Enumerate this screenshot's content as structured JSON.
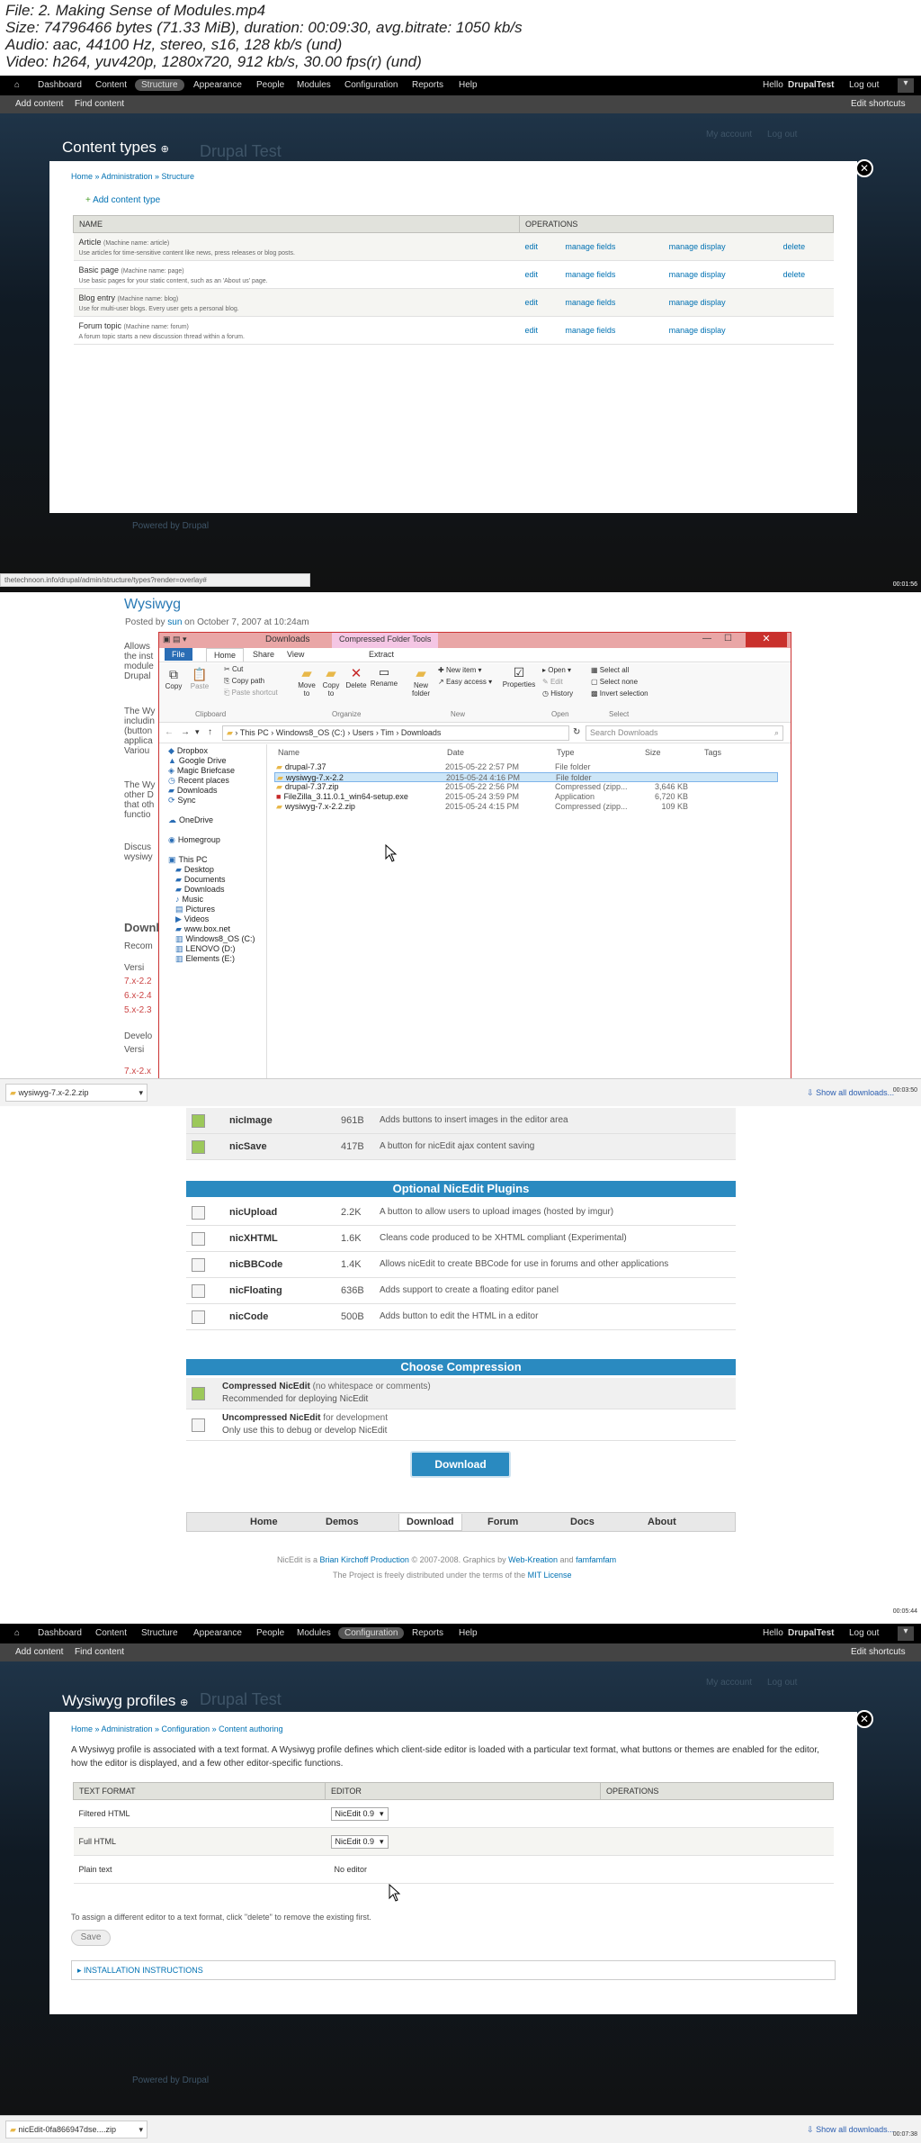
{
  "meta": {
    "file": "File: 2. Making Sense of Modules.mp4",
    "size": "Size: 74796466 bytes (71.33 MiB), duration: 00:09:30, avg.bitrate: 1050 kb/s",
    "audio": "Audio: aac, 44100 Hz, stereo, s16, 128 kb/s (und)",
    "video": "Video: h264, yuv420p, 1280x720, 912 kb/s, 30.00 fps(r) (und)"
  },
  "toolbar": {
    "items": [
      "Dashboard",
      "Content",
      "Structure",
      "Appearance",
      "People",
      "Modules",
      "Configuration",
      "Reports",
      "Help"
    ],
    "hello": "Hello",
    "user": "DrupalTest",
    "logout": "Log out",
    "sub_add": "Add content",
    "sub_find": "Find content",
    "edit_shortcuts": "Edit shortcuts",
    "my_account": "My account",
    "log_out_faint": "Log out",
    "site_name": "Drupal Test",
    "powered": "Powered by Drupal"
  },
  "frame1": {
    "title": "Content types",
    "breadcrumb": "Home » Administration » Structure",
    "add_link": "Add content type",
    "headers": [
      "NAME",
      "OPERATIONS"
    ],
    "rows": [
      {
        "name": "Article",
        "machine": "(Machine name: article)",
        "desc": "Use articles for time-sensitive content like news, press releases or blog posts.",
        "ops": [
          "edit",
          "manage fields",
          "manage display",
          "delete"
        ]
      },
      {
        "name": "Basic page",
        "machine": "(Machine name: page)",
        "desc": "Use basic pages for your static content, such as an 'About us' page.",
        "ops": [
          "edit",
          "manage fields",
          "manage display",
          "delete"
        ]
      },
      {
        "name": "Blog entry",
        "machine": "(Machine name: blog)",
        "desc": "Use for multi-user blogs. Every user gets a personal blog.",
        "ops": [
          "edit",
          "manage fields",
          "manage display",
          ""
        ]
      },
      {
        "name": "Forum topic",
        "machine": "(Machine name: forum)",
        "desc": "A forum topic starts a new discussion thread within a forum.",
        "ops": [
          "edit",
          "manage fields",
          "manage display",
          ""
        ]
      }
    ],
    "status_url": "thetechnoon.info/drupal/admin/structure/types?render=overlay#",
    "timecode": "00:01:56"
  },
  "frame2": {
    "page_title": "Wysiwyg",
    "posted_prefix": "Posted by",
    "posted_user": "sun",
    "posted_rest": "on October 7, 2007 at 10:24am",
    "bg_fragments": [
      "Allows",
      "the inst",
      "module",
      "Drupal",
      "The Wy",
      "includin",
      "(button",
      "applica",
      "Variou",
      "The Wy",
      "other D",
      "that oth",
      "functio",
      "Discus",
      "wysiwy",
      "Downl",
      "Recom",
      "Versi",
      "7.x-2.2",
      "6.x-2.4",
      "5.x-2.3",
      "Develo",
      "Versi",
      "7.x-2.x"
    ],
    "explorer": {
      "title": "Downloads",
      "tools_tab": "Compressed Folder Tools",
      "tabs": [
        "File",
        "Home",
        "Share",
        "View",
        "Extract"
      ],
      "clipboard_btns": [
        "Copy",
        "Paste",
        "Cut",
        "Copy path",
        "Paste shortcut"
      ],
      "groups": [
        "Clipboard",
        "Organize",
        "New",
        "Open",
        "Select"
      ],
      "organize_btns": [
        "Move to",
        "Copy to",
        "Delete",
        "Rename"
      ],
      "new_btns": [
        "New folder",
        "New item",
        "Easy access"
      ],
      "open_btns": [
        "Properties",
        "Open",
        "Edit",
        "History"
      ],
      "select_btns": [
        "Select all",
        "Select none",
        "Invert selection"
      ],
      "path": [
        "This PC",
        "Windows8_OS (C:)",
        "Users",
        "Tim",
        "Downloads"
      ],
      "search_placeholder": "Search Downloads",
      "nav": [
        "Dropbox",
        "Google Drive",
        "Magic Briefcase",
        "Recent places",
        "Downloads",
        "Sync",
        "OneDrive",
        "Homegroup",
        "This PC",
        "Desktop",
        "Documents",
        "Downloads",
        "Music",
        "Pictures",
        "Videos",
        "www.box.net",
        "Windows8_OS (C:)",
        "LENOVO (D:)",
        "Elements (E:)"
      ],
      "columns": [
        "Name",
        "Date",
        "Type",
        "Size",
        "Tags"
      ],
      "files": [
        {
          "name": "drupal-7.37",
          "date": "2015-05-22 2:57 PM",
          "type": "File folder",
          "size": ""
        },
        {
          "name": "wysiwyg-7.x-2.2",
          "date": "2015-05-24 4:16 PM",
          "type": "File folder",
          "size": ""
        },
        {
          "name": "drupal-7.37.zip",
          "date": "2015-05-22 2:56 PM",
          "type": "Compressed (zipp...",
          "size": "3,646 KB"
        },
        {
          "name": "FileZilla_3.11.0.1_win64-setup.exe",
          "date": "2015-05-24 3:59 PM",
          "type": "Application",
          "size": "6,720 KB"
        },
        {
          "name": "wysiwyg-7.x-2.2.zip",
          "date": "2015-05-24 4:15 PM",
          "type": "Compressed (zipp...",
          "size": "109 KB"
        }
      ]
    },
    "download_chip": "wysiwyg-7.x-2.2.zip",
    "show_all": "Show all downloads...",
    "timecode": "00:03:50"
  },
  "frame3": {
    "top_plugins": [
      {
        "name": "nicImage",
        "size": "961B",
        "desc": "Adds buttons to insert images in the editor area",
        "checked": true
      },
      {
        "name": "nicSave",
        "size": "417B",
        "desc": "A button for nicEdit ajax content saving",
        "checked": true
      }
    ],
    "optional_header": "Optional NicEdit Plugins",
    "optional": [
      {
        "name": "nicUpload",
        "size": "2.2K",
        "desc": "A button to allow users to upload images (hosted by imgur)"
      },
      {
        "name": "nicXHTML",
        "size": "1.6K",
        "desc": "Cleans code produced to be XHTML compliant (Experimental)"
      },
      {
        "name": "nicBBCode",
        "size": "1.4K",
        "desc": "Allows nicEdit to create BBCode for use in forums and other applications"
      },
      {
        "name": "nicFloating",
        "size": "636B",
        "desc": "Adds support to create a floating editor panel"
      },
      {
        "name": "nicCode",
        "size": "500B",
        "desc": "Adds button to edit the HTML in a editor"
      }
    ],
    "compression_header": "Choose Compression",
    "compression": [
      {
        "title": "Compressed NicEdit",
        "note": "(no whitespace or comments)",
        "line2": "Recommended for deploying NicEdit",
        "checked": true
      },
      {
        "title": "Uncompressed NicEdit",
        "note": "for development",
        "line2": "Only use this to debug or develop NicEdit",
        "checked": false
      }
    ],
    "download_btn": "Download",
    "nav": [
      "Home",
      "Demos",
      "Download",
      "Forum",
      "Docs",
      "About"
    ],
    "footer1_a": "NicEdit is a",
    "footer1_b": "Brian Kirchoff Production",
    "footer1_c": "© 2007-2008. Graphics by",
    "footer1_d": "Web-Kreation",
    "footer1_e": "and",
    "footer1_f": "famfamfam",
    "footer2_a": "The Project is freely distributed under the terms of the",
    "footer2_b": "MIT License",
    "timecode": "00:05:44"
  },
  "frame4": {
    "title": "Wysiwyg profiles",
    "breadcrumb": "Home » Administration » Configuration » Content authoring",
    "intro": "A Wysiwyg profile is associated with a text format. A Wysiwyg profile defines which client-side editor is loaded with a particular text format, what buttons or themes are enabled for the editor, how the editor is displayed, and a few other editor-specific functions.",
    "headers": [
      "TEXT FORMAT",
      "EDITOR",
      "OPERATIONS"
    ],
    "rows": [
      {
        "format": "Filtered HTML",
        "editor": "NicEdit 0.9"
      },
      {
        "format": "Full HTML",
        "editor": "NicEdit 0.9"
      },
      {
        "format": "Plain text",
        "editor": "No editor"
      }
    ],
    "hint": "To assign a different editor to a text format, click \"delete\" to remove the existing first.",
    "save": "Save",
    "install": "INSTALLATION INSTRUCTIONS",
    "download_chip": "nicEdit-0fa866947dse....zip",
    "show_all": "Show all downloads...",
    "timecode": "00:07:38"
  }
}
